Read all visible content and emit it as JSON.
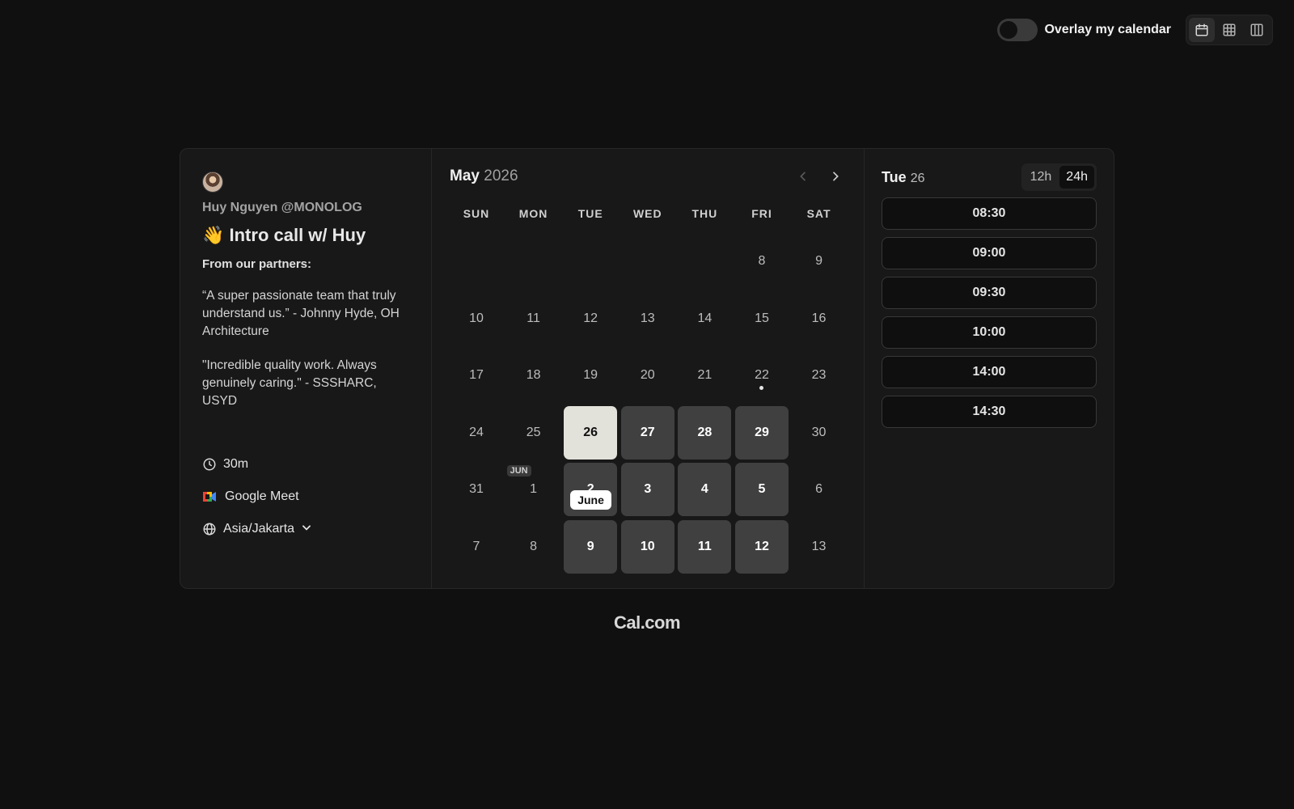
{
  "toolbar": {
    "overlay_label": "Overlay my calendar",
    "overlay_on": false,
    "views": [
      {
        "icon": "calendar-month-icon",
        "active": true
      },
      {
        "icon": "grid-week-icon",
        "active": false
      },
      {
        "icon": "columns-icon",
        "active": false
      }
    ]
  },
  "event": {
    "organizer": "Huy Nguyen @MONOLOG",
    "title": "👋 Intro call w/ Huy",
    "description_heading": "From our partners:",
    "quote1": "“A super passionate team that truly understand us.” - Johnny Hyde, OH Architecture",
    "quote2": "\"Incredible quality work. Always genuinely caring.\" - SSSHARC, USYD",
    "duration": "30m",
    "location": "Google Meet",
    "timezone": "Asia/Jakarta"
  },
  "calendar": {
    "month": "May",
    "year": "2026",
    "weekdays": [
      "SUN",
      "MON",
      "TUE",
      "WED",
      "THU",
      "FRI",
      "SAT"
    ],
    "next_month_badge": "JUN",
    "tooltip": "June",
    "days": [
      {
        "label": "",
        "state": "empty"
      },
      {
        "label": "",
        "state": "empty"
      },
      {
        "label": "",
        "state": "empty"
      },
      {
        "label": "",
        "state": "empty"
      },
      {
        "label": "",
        "state": "empty"
      },
      {
        "label": "8",
        "state": "off"
      },
      {
        "label": "9",
        "state": "off"
      },
      {
        "label": "10",
        "state": "off"
      },
      {
        "label": "11",
        "state": "off"
      },
      {
        "label": "12",
        "state": "off"
      },
      {
        "label": "13",
        "state": "off"
      },
      {
        "label": "14",
        "state": "off"
      },
      {
        "label": "15",
        "state": "off"
      },
      {
        "label": "16",
        "state": "off"
      },
      {
        "label": "17",
        "state": "off"
      },
      {
        "label": "18",
        "state": "off"
      },
      {
        "label": "19",
        "state": "off"
      },
      {
        "label": "20",
        "state": "off"
      },
      {
        "label": "21",
        "state": "off"
      },
      {
        "label": "22",
        "state": "off",
        "today": true
      },
      {
        "label": "23",
        "state": "off"
      },
      {
        "label": "24",
        "state": "off"
      },
      {
        "label": "25",
        "state": "off"
      },
      {
        "label": "26",
        "state": "selected"
      },
      {
        "label": "27",
        "state": "available"
      },
      {
        "label": "28",
        "state": "available"
      },
      {
        "label": "29",
        "state": "available"
      },
      {
        "label": "30",
        "state": "off"
      },
      {
        "label": "31",
        "state": "off"
      },
      {
        "label": "1",
        "state": "off",
        "badge": true
      },
      {
        "label": "2",
        "state": "available",
        "tooltip": true
      },
      {
        "label": "3",
        "state": "available"
      },
      {
        "label": "4",
        "state": "available"
      },
      {
        "label": "5",
        "state": "available"
      },
      {
        "label": "6",
        "state": "off"
      },
      {
        "label": "7",
        "state": "off"
      },
      {
        "label": "8",
        "state": "off"
      },
      {
        "label": "9",
        "state": "available"
      },
      {
        "label": "10",
        "state": "available"
      },
      {
        "label": "11",
        "state": "available"
      },
      {
        "label": "12",
        "state": "available"
      },
      {
        "label": "13",
        "state": "off"
      }
    ]
  },
  "slots": {
    "day_name": "Tue",
    "day_number": "26",
    "format_12h": "12h",
    "format_24h": "24h",
    "active_format": "24h",
    "times": [
      "08:30",
      "09:00",
      "09:30",
      "10:00",
      "14:00",
      "14:30"
    ]
  },
  "brand": "Cal.com"
}
